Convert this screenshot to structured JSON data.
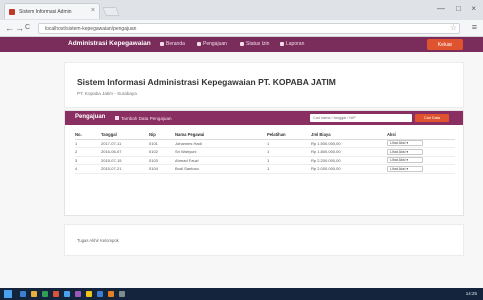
{
  "browser": {
    "tab_title": "Sistem Informasi Admin",
    "tab_close": "×",
    "address": "localhost/sistem-kepegawaian/pengajuan",
    "back": "←",
    "forward": "→",
    "reload": "C",
    "menu": "≡",
    "star": "☆",
    "minimize": "—",
    "maximize": "□",
    "close": "×"
  },
  "topnav": {
    "brand": "Administrasi Kepegawaian",
    "items": [
      "Beranda",
      "Pengajuan",
      "Status Izin",
      "Laporan"
    ],
    "logout": "Keluar"
  },
  "header": {
    "title": "Sistem Informasi Administrasi Kepegawaian PT. KOPABA JATIM",
    "subtitle": "PT. Kopaba Jatim - Surabaya"
  },
  "panel": {
    "title": "Pengajuan",
    "add_label": "Tambah Data Pengajuan",
    "search_placeholder": "Cari nama / tanggal / NIP",
    "search_button": "Cari Data",
    "columns": [
      "No.",
      "Tanggal",
      "Nip",
      "Nama Pegawai",
      "Pelatihan",
      "Jml Biaya",
      "Aksi"
    ],
    "rows": [
      {
        "no": "1",
        "tanggal": "2017-07-11",
        "nip": "0101",
        "nama": "Johannes Hadi",
        "pelatihan": "1",
        "biaya": "Rp 1.500.000,00",
        "aksi": "Lihat Aksi"
      },
      {
        "no": "2",
        "tanggal": "2016-06-07",
        "nip": "0102",
        "nama": "Sri Wahyuni",
        "pelatihan": "1",
        "biaya": "Rp 1.800.000,00",
        "aksi": "Lihat Aksi"
      },
      {
        "no": "3",
        "tanggal": "2015-07-15",
        "nip": "0103",
        "nama": "Ahmad Fauzi",
        "pelatihan": "1",
        "biaya": "Rp 2.200.000,00",
        "aksi": "Lihat Aksi"
      },
      {
        "no": "4",
        "tanggal": "2015-07-21",
        "nip": "0104",
        "nama": "Budi Santoso",
        "pelatihan": "1",
        "biaya": "Rp 2.000.000,00",
        "aksi": "Lihat Aksi"
      }
    ]
  },
  "footer": {
    "text": "Tugas Akhir Kelompok"
  },
  "taskbar": {
    "clock": "14:25",
    "icon_colors": [
      "#3b7fd1",
      "#e8b03a",
      "#2f9e57",
      "#d9523a",
      "#4aa3f0",
      "#9b59b6",
      "#f0c419",
      "#3b7fd1",
      "#e67e22",
      "#7f8c8d"
    ]
  },
  "colors": {
    "nav_bg": "#7a2c5b",
    "panel_head": "#8a2f62",
    "accent": "#e0532f"
  }
}
